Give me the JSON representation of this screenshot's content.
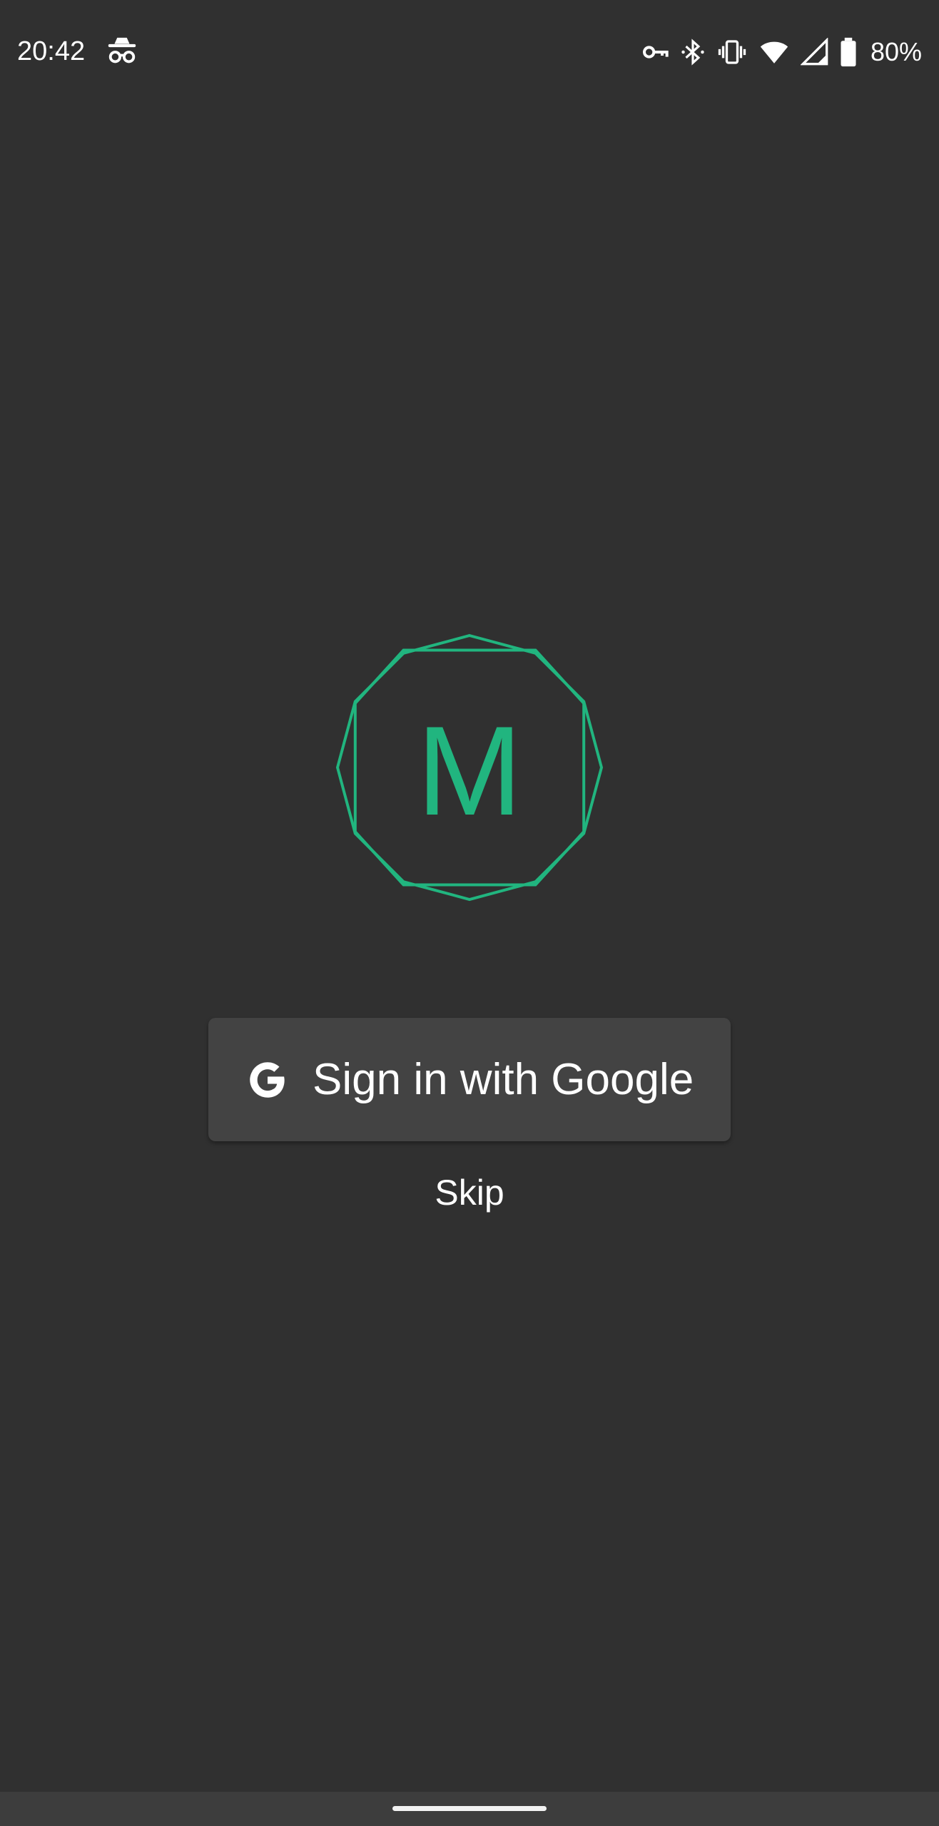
{
  "status_bar": {
    "time": "20:42",
    "battery_percent": "80%",
    "icons": [
      "incognito-icon",
      "vpn-key-icon",
      "bluetooth-icon",
      "vibrate-icon",
      "wifi-icon",
      "cellular-signal-icon",
      "battery-icon"
    ]
  },
  "logo": {
    "letter": "M",
    "color": "#21b57f"
  },
  "signin": {
    "label": "Sign in with Google",
    "icon": "google-g-icon"
  },
  "skip": {
    "label": "Skip"
  },
  "colors": {
    "background": "#303030",
    "button": "#434343",
    "accent": "#21b57f"
  }
}
